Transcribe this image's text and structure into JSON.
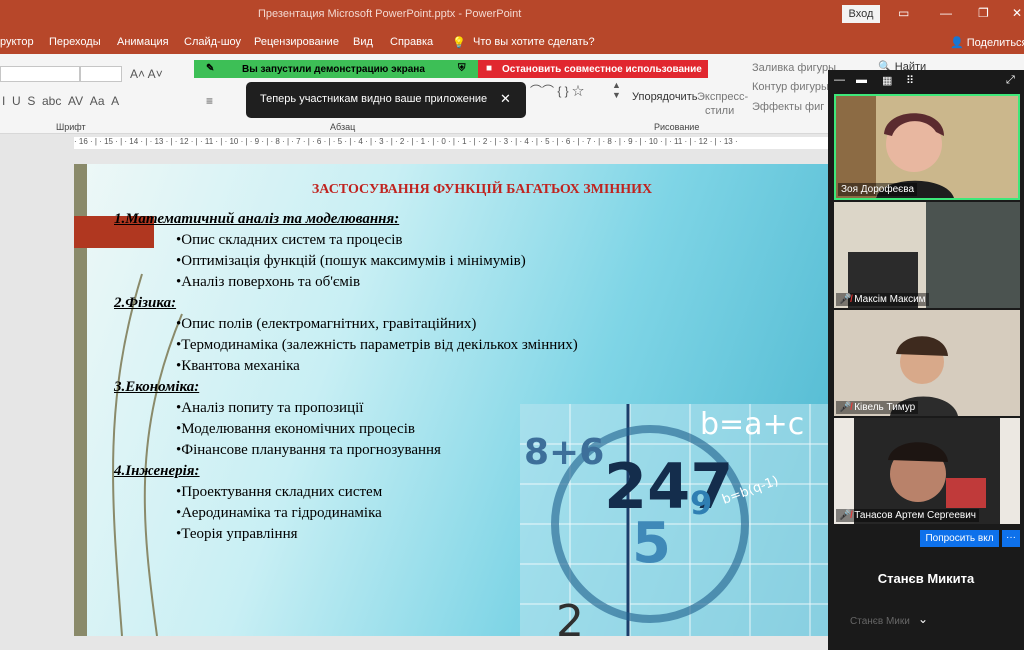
{
  "window": {
    "title": "Презентация Microsoft PowerPoint.pptx  -  PowerPoint",
    "signin": "Вход"
  },
  "menu": {
    "items": [
      "руктор",
      "Переходы",
      "Анимация",
      "Слайд-шоу",
      "Рецензирование",
      "Вид",
      "Справка"
    ],
    "search": "Что вы хотите сделать?",
    "share": "Поделиться"
  },
  "ribbon": {
    "groups": {
      "font": "Шрифт",
      "paragraph": "Абзац",
      "drawing": "Рисование"
    },
    "arrange": "Упорядочить",
    "express1": "Экспресс-",
    "express2": "стили",
    "fill": "Заливка фигуры",
    "outline": "Контур фигуры",
    "effects": "Эффекты фиг",
    "find": "Найти"
  },
  "share": {
    "running": "Вы запустили демонстрацию экрана",
    "stop": "Остановить совместное использование",
    "toast": "Теперь участникам видно ваше приложение"
  },
  "ruler": "· 16 · | · 15 · | · 14 · | · 13 · | · 12 · | · 11 · | · 10 · | · 9 · | · 8 · | · 7 · | · 6 · | · 5 · | · 4 · | · 3 · | · 2 · | · 1 · | · 0 · | · 1 · | · 2 · | · 3 · | · 4 · | · 5 · | · 6 · | · 7 · | · 8 · | · 9 · | · 10 · | · 11 · | · 12 · | · 13 ·",
  "slide": {
    "title": "ЗАСТОСУВАННЯ ФУНКЦІЙ БАГАТЬОХ ЗМІННИХ",
    "sections": [
      {
        "heading": "1.Математичний аналіз та моделювання:",
        "items": [
          "•Опис складних систем та процесів",
          "•Оптимізація функцій (пошук максимумів і мінімумів)",
          "•Аналіз поверхонь та об'ємів"
        ]
      },
      {
        "heading": "2.Фізика:",
        "items": [
          "•Опис полів (електромагнітних, гравітаційних)",
          "•Термодинаміка (залежність параметрів від декількох змінних)",
          "•Квантова механіка"
        ]
      },
      {
        "heading": "3.Економіка:",
        "items": [
          "•Аналіз попиту та пропозиції",
          "•Моделювання економічних процесів",
          "•Фінансове планування та прогнозування"
        ]
      },
      {
        "heading": "4.Інженерія:",
        "items": [
          "•Проектування складних систем",
          "•Аеродинаміка та гідродинаміка",
          "•Теорія управління"
        ]
      }
    ],
    "art": {
      "formula1": "8+6",
      "formula2": "b=a+c",
      "digits": "247",
      "handwriting": "b=b(q-1)",
      "nine": "9",
      "five": "5",
      "two": "2"
    }
  },
  "meeting": {
    "participants": [
      "Зоя Дорофеєва",
      "Максім Максим",
      "Ківель Тимур",
      "Танасов Артем Сергеевич"
    ],
    "video_button": "Попросить вкл",
    "more": "···",
    "big_name": "Станєв Микита",
    "next_name": "Станєв Мики"
  },
  "colors": {
    "accent": "#b7472a",
    "share_green": "#3dbf56",
    "share_red": "#e1272f",
    "speaker_border": "#3ee87a",
    "title_red": "#c0231f"
  }
}
